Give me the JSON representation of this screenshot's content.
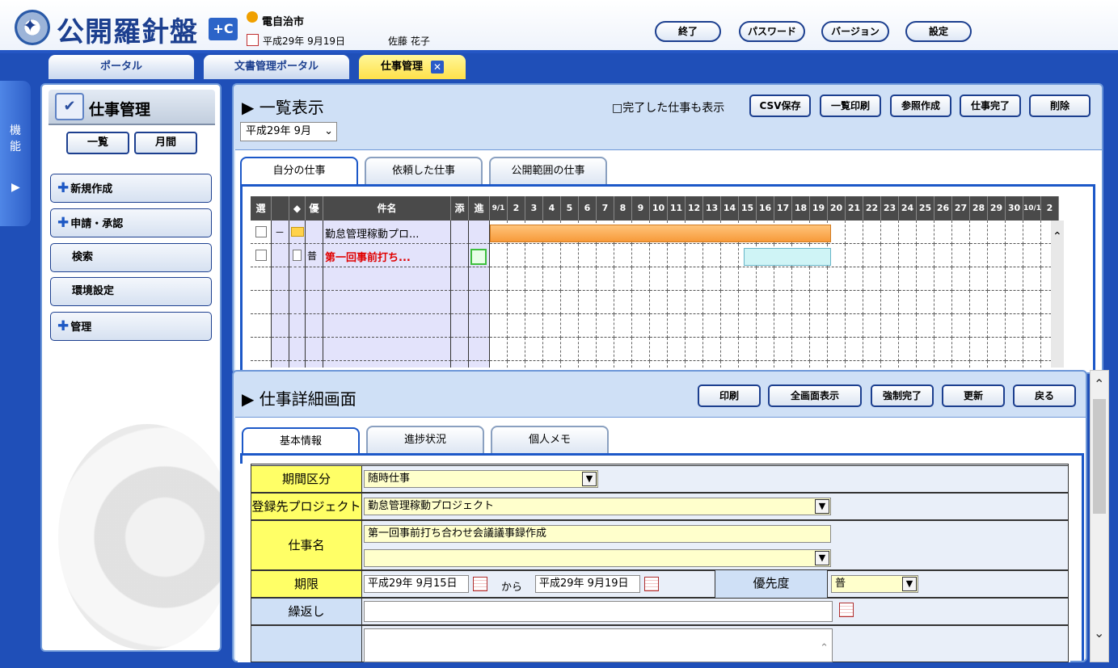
{
  "header": {
    "logo_text": "公開羅針盤",
    "logo_plus": "+C",
    "org": "電自治市",
    "date": "平成29年 9月19日",
    "user": "佐藤 花子",
    "buttons": [
      "終了",
      "パスワード",
      "バージョン",
      "設定"
    ]
  },
  "top_tabs": [
    "ポータル",
    "文書管理ポータル",
    "仕事管理"
  ],
  "side_tab": {
    "label": "機能"
  },
  "left_panel": {
    "title": "仕事管理",
    "view_buttons": [
      "一覧",
      "月間"
    ],
    "menu": [
      {
        "label": "新規作成",
        "plus": true
      },
      {
        "label": "申請・承認",
        "plus": true
      },
      {
        "label": "検索",
        "plus": false
      },
      {
        "label": "環境設定",
        "plus": false
      },
      {
        "label": "管理",
        "plus": true
      }
    ]
  },
  "list": {
    "title": "▶ 一覧表示",
    "show_done_label": "□完了した仕事も表示",
    "actions": [
      "CSV保存",
      "一覧印刷",
      "参照作成",
      "仕事完了",
      "削除"
    ],
    "month": "平成29年 9月",
    "tabs": [
      "自分の仕事",
      "依頼した仕事",
      "公開範囲の仕事"
    ],
    "columns": [
      "選",
      "◆",
      "優",
      "件名",
      "添",
      "進"
    ],
    "days": [
      "9/1",
      "2",
      "3",
      "4",
      "5",
      "6",
      "7",
      "8",
      "9",
      "10",
      "11",
      "12",
      "13",
      "14",
      "15",
      "16",
      "17",
      "18",
      "19",
      "20",
      "21",
      "22",
      "23",
      "24",
      "25",
      "26",
      "27",
      "28",
      "29",
      "30",
      "10/1",
      "2"
    ],
    "rows": [
      {
        "marker": "－",
        "priority": "",
        "name": "勤怠管理稼動プロ...",
        "color": "#000000"
      },
      {
        "marker": "",
        "priority": "普",
        "name": "第一回事前打ち...",
        "color": "#e00000"
      }
    ]
  },
  "detail": {
    "title": "▶ 仕事詳細画面",
    "actions": [
      "印刷",
      "全画面表示",
      "強制完了",
      "更新",
      "戻る"
    ],
    "tabs": [
      "基本情報",
      "進捗状況",
      "個人メモ"
    ],
    "fields": {
      "period_label": "期間区分",
      "period_value": "随時仕事",
      "project_label": "登録先プロジェクト",
      "project_value": "勤怠管理稼動プロジェクト",
      "name_label": "仕事名",
      "name_value": "第一回事前打ち合わせ会議議事録作成",
      "deadline_label": "期限",
      "deadline_from": "平成29年 9月15日",
      "from_to": "から",
      "deadline_to": "平成29年 9月19日",
      "priority_label": "優先度",
      "priority_value": "普",
      "repeat_label": "繰返し"
    }
  }
}
